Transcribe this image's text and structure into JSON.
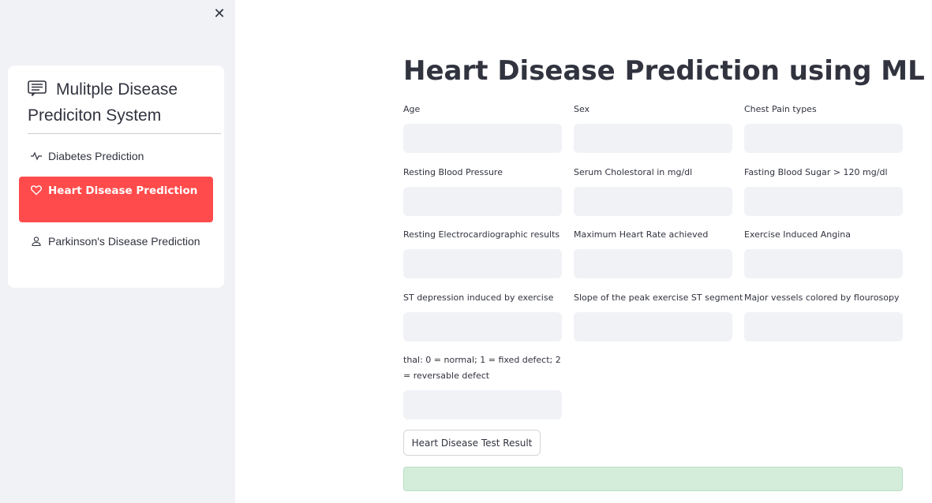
{
  "sidebar": {
    "close_symbol": "✕",
    "menu_title": "Mulitple Disease Prediciton System",
    "menu_title_icon": "list-icon",
    "items": [
      {
        "label": "Diabetes Prediction",
        "icon": "activity-icon",
        "active": false
      },
      {
        "label": "Heart Disease Prediction",
        "icon": "heart-icon",
        "active": true
      },
      {
        "label": "Parkinson's Disease Prediction",
        "icon": "person-icon",
        "active": false
      }
    ]
  },
  "main": {
    "title": "Heart Disease Prediction using ML",
    "fields": [
      {
        "label": "Age",
        "value": ""
      },
      {
        "label": "Sex",
        "value": ""
      },
      {
        "label": "Chest Pain types",
        "value": ""
      },
      {
        "label": "Resting Blood Pressure",
        "value": ""
      },
      {
        "label": "Serum Cholestoral in mg/dl",
        "value": ""
      },
      {
        "label": "Fasting Blood Sugar > 120 mg/dl",
        "value": ""
      },
      {
        "label": "Resting Electrocardiographic results",
        "value": ""
      },
      {
        "label": "Maximum Heart Rate achieved",
        "value": ""
      },
      {
        "label": "Exercise Induced Angina",
        "value": ""
      },
      {
        "label": "ST depression induced by exercise",
        "value": ""
      },
      {
        "label": "Slope of the peak exercise ST segment",
        "value": ""
      },
      {
        "label": "Major vessels colored by flourosopy",
        "value": ""
      },
      {
        "label": "thal: 0 = normal; 1 = fixed defect; 2 = reversable defect",
        "value": ""
      }
    ],
    "submit_label": "Heart Disease Test Result",
    "result_text": ""
  },
  "colors": {
    "accent": "#ff4b4b",
    "sidebar_bg": "#f0f2f6",
    "input_bg": "#f0f2f6",
    "success_bg": "#d4edda"
  }
}
